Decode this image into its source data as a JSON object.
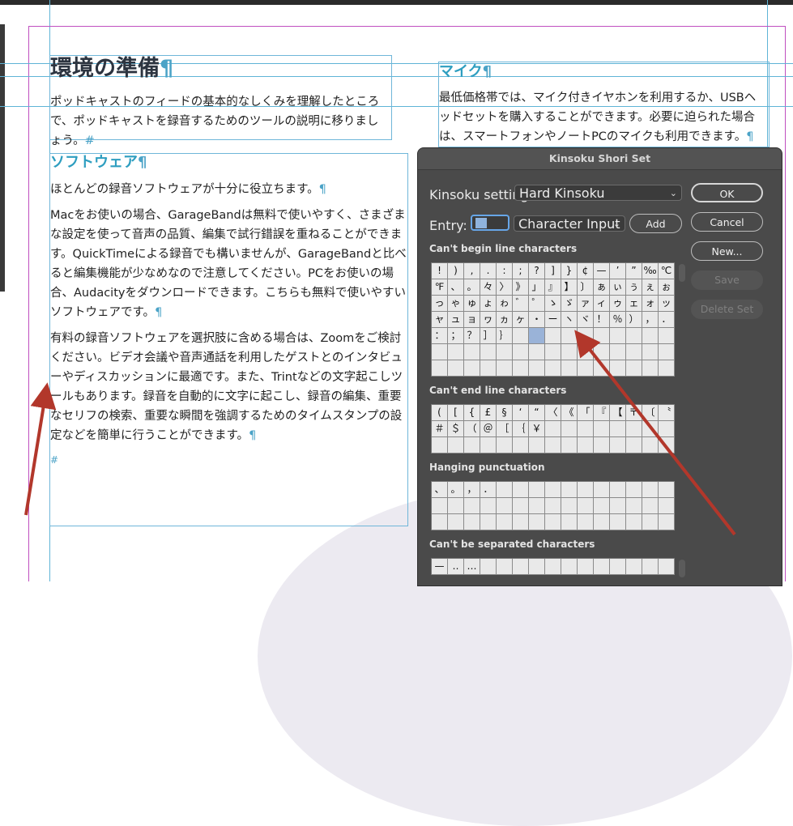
{
  "document": {
    "heading": "環境の準備",
    "intro": "ポッドキャストのフィードの基本的なしくみを理解したところで、ポッドキャストを録音するためのツールの説明に移りましょう。",
    "software_heading": "ソフトウェア",
    "software_p1": "ほとんどの録音ソフトウェアが十分に役立ちます。",
    "software_p2": "Macをお使いの場合、GarageBandは無料で使いやすく、さまざまな設定を使って音声の品質、編集で試行錯誤を重ねることができます。QuickTimeによる録音でも構いませんが、GarageBandと比べると編集機能が少なめなので注意してください。PCをお使いの場合、Audacityをダウンロードできます。こちらも無料で使いやすいソフトウェアです。",
    "software_p3": "有料の録音ソフトウェアを選択肢に含める場合は、Zoomをご検討ください。ビデオ会議や音声通話を利用したゲストとのインタビューやディスカッションに最適です。また、Trintなどの文字起こしツールもあります。録音を自動的に文字に起こし、録音の編集、重要なセリフの検索、重要な瞬間を強調するためのタイムスタンプの設定などを簡単に行うことができます。",
    "mic_heading": "マイク",
    "mic_p": "最低価格帯では、マイク付きイヤホンを利用するか、USBヘッドセットを購入することができます。必要に迫られた場合は、スマートフォンやノートPCのマイクも利用できます。",
    "pilcrow": "¶",
    "end_mark": "#"
  },
  "dialog": {
    "title": "Kinsoku Shori Set",
    "settings_label": "Kinsoku settings:",
    "settings_value": "Hard Kinsoku",
    "entry_label": "Entry:",
    "entry_value": "",
    "input_mode": "Character Input",
    "add_button": "Add",
    "ok_button": "OK",
    "cancel_button": "Cancel",
    "new_button": "New...",
    "save_button": "Save",
    "delete_button": "Delete Set",
    "sections": {
      "cant_begin": "Can't begin line characters",
      "cant_end": "Can't end line characters",
      "hanging": "Hanging punctuation",
      "cant_separate": "Can't be separated characters"
    },
    "cant_begin_chars": [
      "!",
      ")",
      ",",
      ".",
      ":",
      ";",
      "?",
      "]",
      "}",
      "¢",
      "—",
      "’",
      "”",
      "‰",
      "℃",
      "℉",
      "、",
      "。",
      "々",
      "〉",
      "》",
      "」",
      "』",
      "】",
      "〕",
      "ぁ",
      "ぃ",
      "ぅ",
      "ぇ",
      "ぉ",
      "っ",
      "ゃ",
      "ゅ",
      "ょ",
      "ゎ",
      "゛",
      "゜",
      "ゝ",
      "ゞ",
      "ァ",
      "ィ",
      "ゥ",
      "ェ",
      "ォ",
      "ッ",
      "ャ",
      "ュ",
      "ョ",
      "ヮ",
      "ヵ",
      "ヶ",
      "・",
      "ー",
      "ヽ",
      "ヾ",
      "！",
      "％",
      "）",
      "，",
      "．",
      "：",
      "；",
      "？",
      "］",
      "｝"
    ],
    "cant_end_chars": [
      "(",
      "[",
      "{",
      "£",
      "§",
      "‘",
      "“",
      "〈",
      "《",
      "「",
      "『",
      "【",
      "〒",
      "〔",
      "〝",
      "＃",
      "＄",
      "（",
      "＠",
      "［",
      "｛",
      "￥"
    ],
    "hanging_chars": [
      "、",
      "。",
      "，",
      "．"
    ],
    "cant_separate_chars": [
      "—",
      "‥",
      "…"
    ]
  }
}
